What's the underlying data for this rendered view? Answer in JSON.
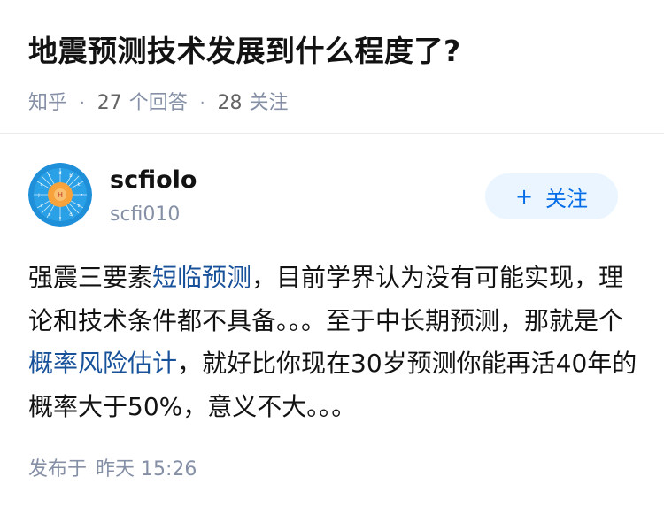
{
  "question": {
    "title": "地震预测技术发展到什么程度了?",
    "source": "知乎",
    "answer_count": "27",
    "answer_label": "个回答",
    "follower_count": "28",
    "follower_label": "关注"
  },
  "author": {
    "name": "scfiolo",
    "handle": "scfi010",
    "avatar_icon": "zodiac-wheel-avatar",
    "follow_icon": "plus-icon",
    "follow_plus": "+",
    "follow_label": "关注"
  },
  "answer": {
    "segments": [
      {
        "text": "强震三要素",
        "link": false
      },
      {
        "text": "短临预测",
        "link": true
      },
      {
        "text": "，目前学界认为没有可能实现，理论和技术条件都不具备。。。至于中长期预测，那就是个",
        "link": false
      },
      {
        "text": "概率风险估计",
        "link": true
      },
      {
        "text": "，就好比你现在30岁预测你能再活40年的概率大于50%，意义不大。。。",
        "link": false
      }
    ]
  },
  "footer": {
    "publish_label": "发布于",
    "publish_time": "昨天 15:26"
  },
  "colors": {
    "link": "#175199",
    "meta": "#8590a6",
    "follow_bg": "#ebf5ff",
    "follow_fg": "#056de8",
    "avatar_blue": "#1e8fd8",
    "avatar_orange": "#f7a23b"
  }
}
